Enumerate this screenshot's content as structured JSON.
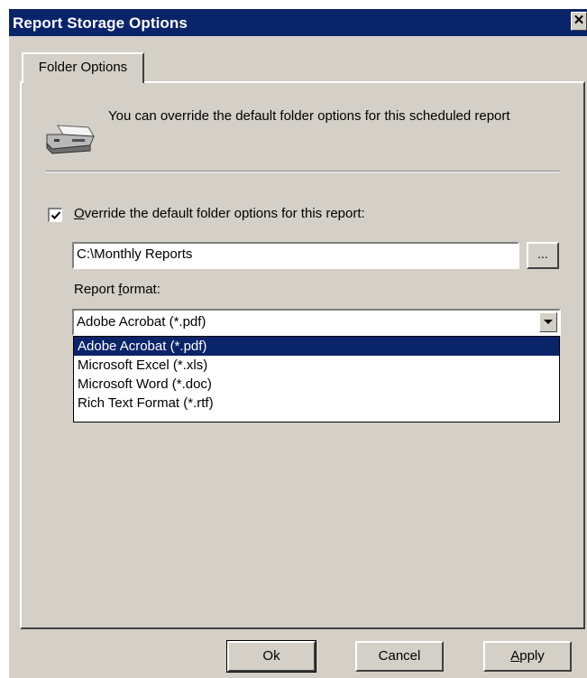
{
  "window": {
    "title": "Report Storage Options",
    "close_glyph": "✕"
  },
  "tabs": [
    {
      "label": "Folder Options",
      "active": true
    }
  ],
  "info": {
    "icon": "drive-icon",
    "text": "You can override the default folder options for this scheduled report"
  },
  "override": {
    "checked": true,
    "label_mnemonic": "O",
    "label_rest": "verride the default folder options for this report:"
  },
  "folder_path": {
    "value": "C:\\Monthly Reports",
    "browse_label": "..."
  },
  "report_format": {
    "label_prefix": "Report ",
    "label_mnemonic": "f",
    "label_suffix": "ormat:",
    "selected": "Adobe Acrobat (*.pdf)",
    "options": [
      "Adobe Acrobat (*.pdf)",
      "Microsoft Excel (*.xls)",
      "Microsoft Word (*.doc)",
      "Rich Text Format (*.rtf)"
    ],
    "highlighted_index": 0
  },
  "buttons": {
    "ok": "Ok",
    "cancel": "Cancel",
    "apply_mnemonic": "A",
    "apply_rest": "pply"
  },
  "colors": {
    "title_bar": "#0a246a",
    "face": "#d4d0c8",
    "selection": "#0a246a"
  }
}
